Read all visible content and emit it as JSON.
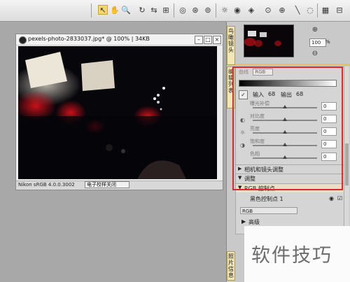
{
  "toolbar": {
    "tools": [
      {
        "name": "arrow-select-icon",
        "glyph": "↖"
      },
      {
        "name": "hand-tool-icon",
        "glyph": "✋"
      },
      {
        "name": "zoom-tool-icon",
        "glyph": "🔍"
      },
      {
        "name": "rotate-icon",
        "glyph": "↻"
      },
      {
        "name": "straighten-icon",
        "glyph": "⇆"
      },
      {
        "name": "crop-icon",
        "glyph": "⊞"
      },
      {
        "name": "red-eye-icon",
        "glyph": "◎"
      },
      {
        "name": "retouch-icon",
        "glyph": "⊛"
      },
      {
        "name": "auto-retouch-icon",
        "glyph": "⊚"
      },
      {
        "name": "brightness-icon",
        "glyph": "☼"
      },
      {
        "name": "preview-eye-icon",
        "glyph": "◉"
      },
      {
        "name": "tag-icon",
        "glyph": "◈"
      },
      {
        "name": "control-point-icon",
        "glyph": "⊙"
      },
      {
        "name": "control-point-plus-icon",
        "glyph": "⊕"
      },
      {
        "name": "brush-icon",
        "glyph": "╲"
      },
      {
        "name": "lasso-icon",
        "glyph": "◌"
      },
      {
        "name": "grid-view-icon",
        "glyph": "▦"
      },
      {
        "name": "compare-icon",
        "glyph": "⊟"
      }
    ]
  },
  "image_window": {
    "title": "pexels-photo-2833037.jpg* @ 100% | 34KB",
    "minimize": "–",
    "maximize": "□",
    "close": "×",
    "status_profile": "Nikon sRGB 4.0.0.3002",
    "status_select": "电子校样关闭"
  },
  "side_panel": {
    "birdseye_tab": "鸟瞰镜头",
    "edit_tab": "编辑列表",
    "photo_info_tab": "照片信息",
    "zoom_value": "100",
    "zoom_unit": "%",
    "curve_title": "曲线",
    "curve_mode": "RGB",
    "input_label": "输入",
    "input_value": "68",
    "output_label": "输出",
    "output_value": "68",
    "sliders": [
      {
        "label": "曝光补偿",
        "value": "0"
      },
      {
        "label": "对比度",
        "value": "0"
      },
      {
        "label": "亮度",
        "value": "0"
      },
      {
        "label": "饱和度",
        "value": "0"
      },
      {
        "label": "色相",
        "value": "0"
      }
    ],
    "lens_section": "相机和镜头调整",
    "adjust_section": "调整",
    "control_section": "RGB 控制点",
    "black_point": "黑色控制点 1",
    "rgb_select": "RGB",
    "advanced": "高级"
  },
  "watermark": "软件技巧",
  "colors": {
    "highlight": "#e2262a",
    "accent": "#e2c264"
  }
}
